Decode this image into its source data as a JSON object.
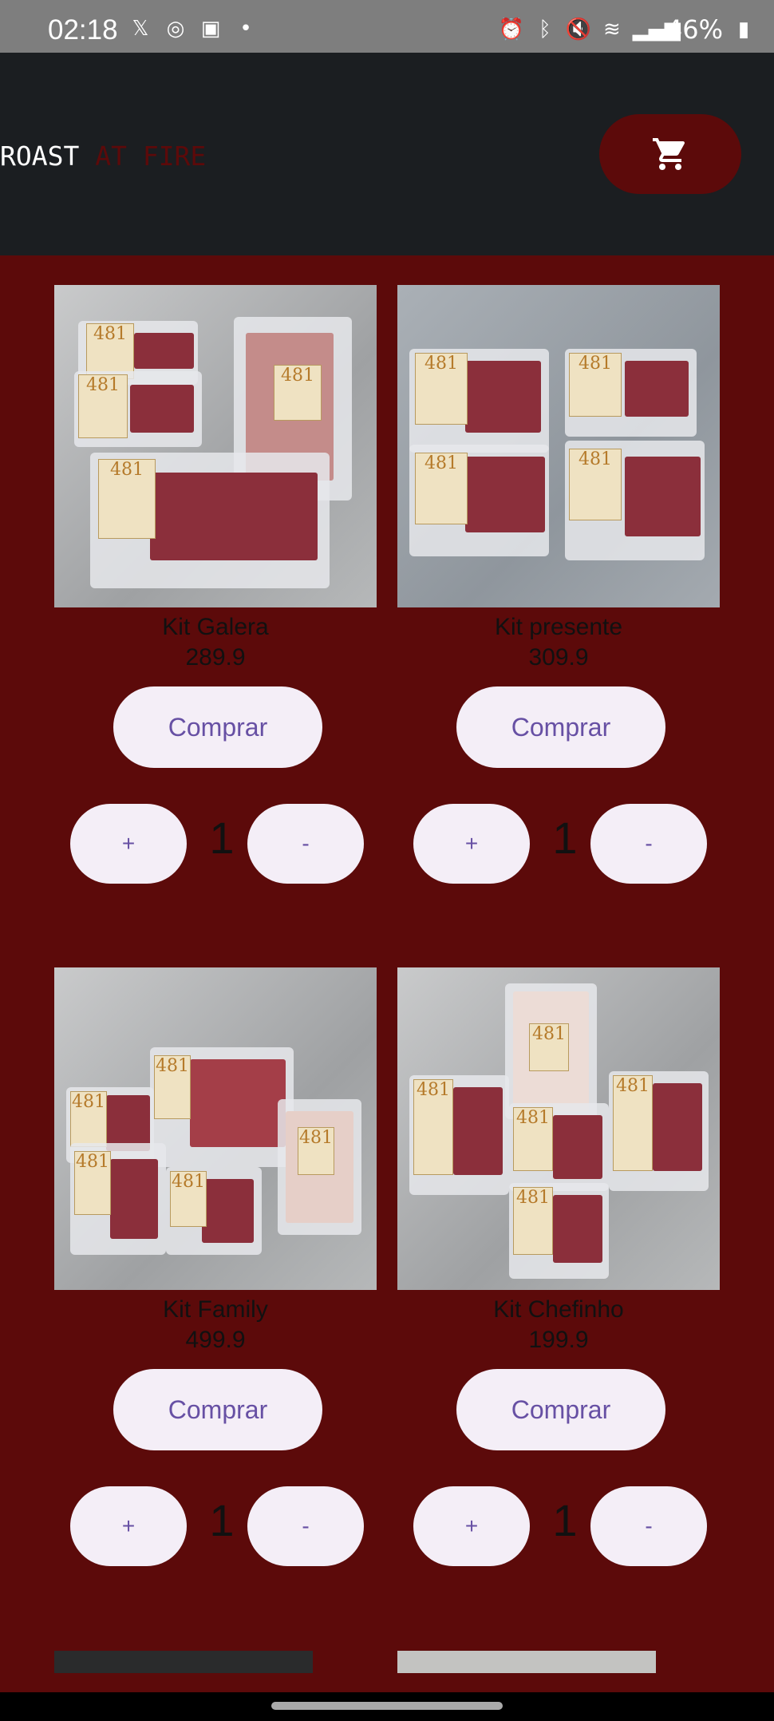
{
  "status_bar": {
    "time": "02:18",
    "battery": "46%",
    "left_icons": [
      "x-icon",
      "instagram-icon",
      "image-icon",
      "dot-icon"
    ],
    "right_icons": [
      "alarm-icon",
      "bluetooth-icon",
      "mute-icon",
      "wifi-icon",
      "signal-icon",
      "battery-icon"
    ]
  },
  "header": {
    "brand_primary": "ROAST",
    "brand_accent": "AT FIRE",
    "cart_icon": "cart-icon"
  },
  "products": [
    {
      "name": "Kit Galera",
      "price": "289.9",
      "buy_label": "Comprar",
      "plus_label": "+",
      "minus_label": "-",
      "quantity": "1"
    },
    {
      "name": "Kit presente",
      "price": "309.9",
      "buy_label": "Comprar",
      "plus_label": "+",
      "minus_label": "-",
      "quantity": "1"
    },
    {
      "name": "Kit Family",
      "price": "499.9",
      "buy_label": "Comprar",
      "plus_label": "+",
      "minus_label": "-",
      "quantity": "1"
    },
    {
      "name": "Kit Chefinho",
      "price": "199.9",
      "buy_label": "Comprar",
      "plus_label": "+",
      "minus_label": "-",
      "quantity": "1"
    }
  ],
  "colors": {
    "background": "#5c0a0a",
    "header": "#1b1e21",
    "button_bg": "#f4eef7",
    "button_text": "#6750a4"
  }
}
